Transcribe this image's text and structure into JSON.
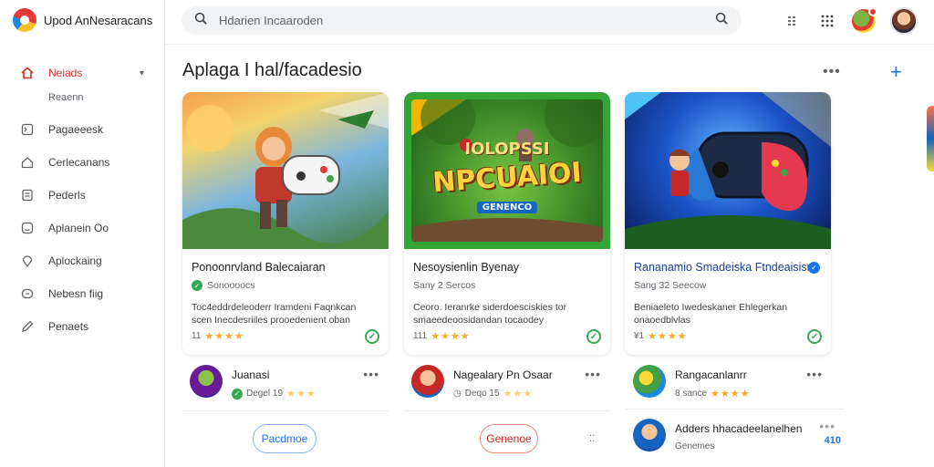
{
  "app": {
    "name": "Upod AnNesaracans"
  },
  "sidebar": {
    "items": [
      {
        "label": "Neiads",
        "sub": "Reaenn"
      },
      {
        "label": "Pagaeeesk"
      },
      {
        "label": "Cerlecanans"
      },
      {
        "label": "Pederls"
      },
      {
        "label": "Aplanein Oo"
      },
      {
        "label": "Aplockaing"
      },
      {
        "label": "Nebesn fiig"
      },
      {
        "label": "Penaets"
      }
    ]
  },
  "search": {
    "placeholder": "Hdarien Incaaroden"
  },
  "main": {
    "title": "Aplaga I hal/facadesio"
  },
  "cards": [
    {
      "title": "Ponoonrvland Balecaiaran",
      "subtitle": "Sonoooocs",
      "desc": "Toc4eddrdeleoderr Iramdeni Faqnkcan scen Inecdesriiles prooedenient oban",
      "rating_count": "11",
      "stars": "★★★★"
    },
    {
      "title": "Nesoysienlin Byenay",
      "subtitle": "Sany 2 Sercos",
      "desc": "Ceoro. Ieranrke siderdoesciskies tor smaeedeoosidandan tocaodey",
      "rating_count": "111",
      "stars": "★★★★",
      "art_text": "NPCUAIOI",
      "art_top": "IOLOPSSI",
      "art_sub": "GENENCO"
    },
    {
      "title": "Rananamio Smadeiska Ftndeaisisn",
      "subtitle": "Sang 32 Seecow",
      "desc": "Beniaeleto Iwedeskaner Ehlegerkan onaoedblvlas",
      "rating_count": "¥1",
      "stars": "★★★★"
    }
  ],
  "list": [
    {
      "name": "Juanasi",
      "meta": "Degel 19",
      "stars": "★★★"
    },
    {
      "name": "Nagealary Pn Osaar",
      "meta": "Deqo 15",
      "stars": "★★★"
    },
    {
      "name": "Rangacanlanrr",
      "meta": "8 sance",
      "stars": "★★★★"
    },
    {
      "name": "Adders hhacadeelanelhen",
      "meta": "Genemes",
      "badge": "410"
    }
  ],
  "buttons": {
    "first": "Pacdmoe",
    "second": "Genenoe"
  },
  "colors": {
    "accent": "#1a73e8",
    "active": "#d93025",
    "star": "#f9a825",
    "verified": "#34a853"
  }
}
